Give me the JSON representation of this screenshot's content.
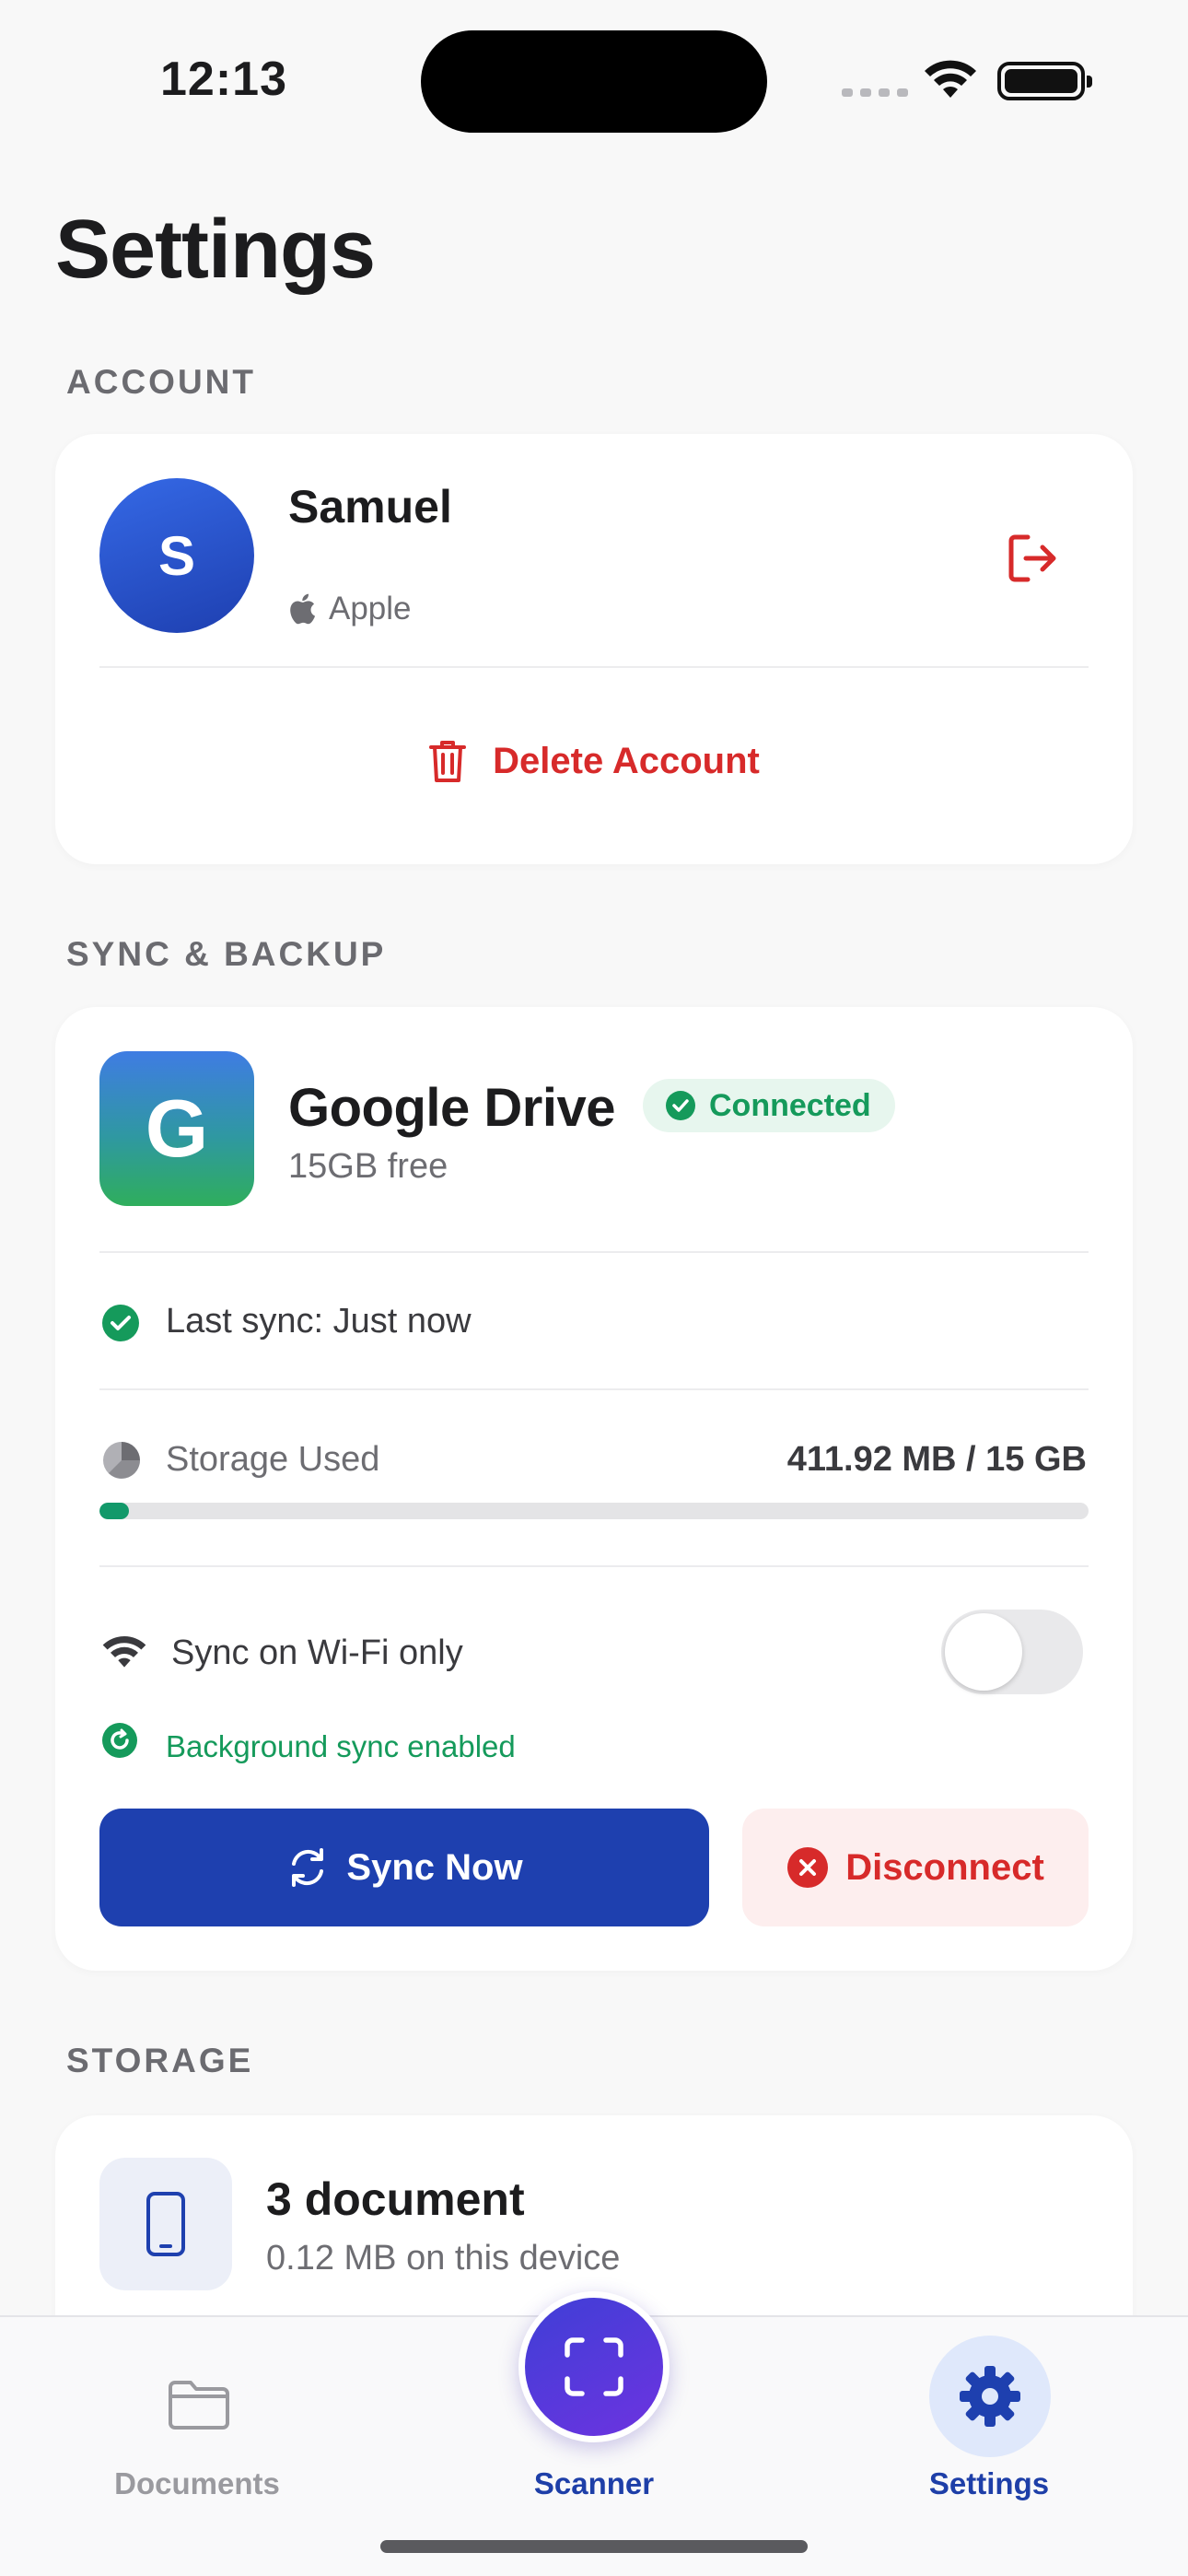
{
  "status_bar": {
    "time": "12:13"
  },
  "page_title": "Settings",
  "account": {
    "section_label": "ACCOUNT",
    "avatar_initial": "S",
    "name": "Samuel",
    "provider": "Apple",
    "delete_label": "Delete Account"
  },
  "sync": {
    "section_label": "SYNC & BACKUP",
    "service_initial": "G",
    "service_name": "Google Drive",
    "status_badge": "Connected",
    "free_space": "15GB free",
    "last_sync": "Last sync: Just now",
    "storage_label": "Storage Used",
    "storage_value": "411.92 MB / 15 GB",
    "storage_fraction": 0.027,
    "wifi_only_label": "Sync on Wi-Fi only",
    "wifi_only_enabled": false,
    "background_sync": "Background sync enabled",
    "sync_now_label": "Sync Now",
    "disconnect_label": "Disconnect"
  },
  "storage": {
    "section_label": "STORAGE",
    "doc_count": "3 document",
    "doc_size": "0.12 MB on this device"
  },
  "tabbar": {
    "documents_label": "Documents",
    "scanner_label": "Scanner",
    "settings_label": "Settings",
    "active_tab": "Settings"
  },
  "colors": {
    "accent": "#1e40af",
    "success": "#159a5b",
    "danger": "#d72a2a",
    "background": "#f8f8f8"
  }
}
